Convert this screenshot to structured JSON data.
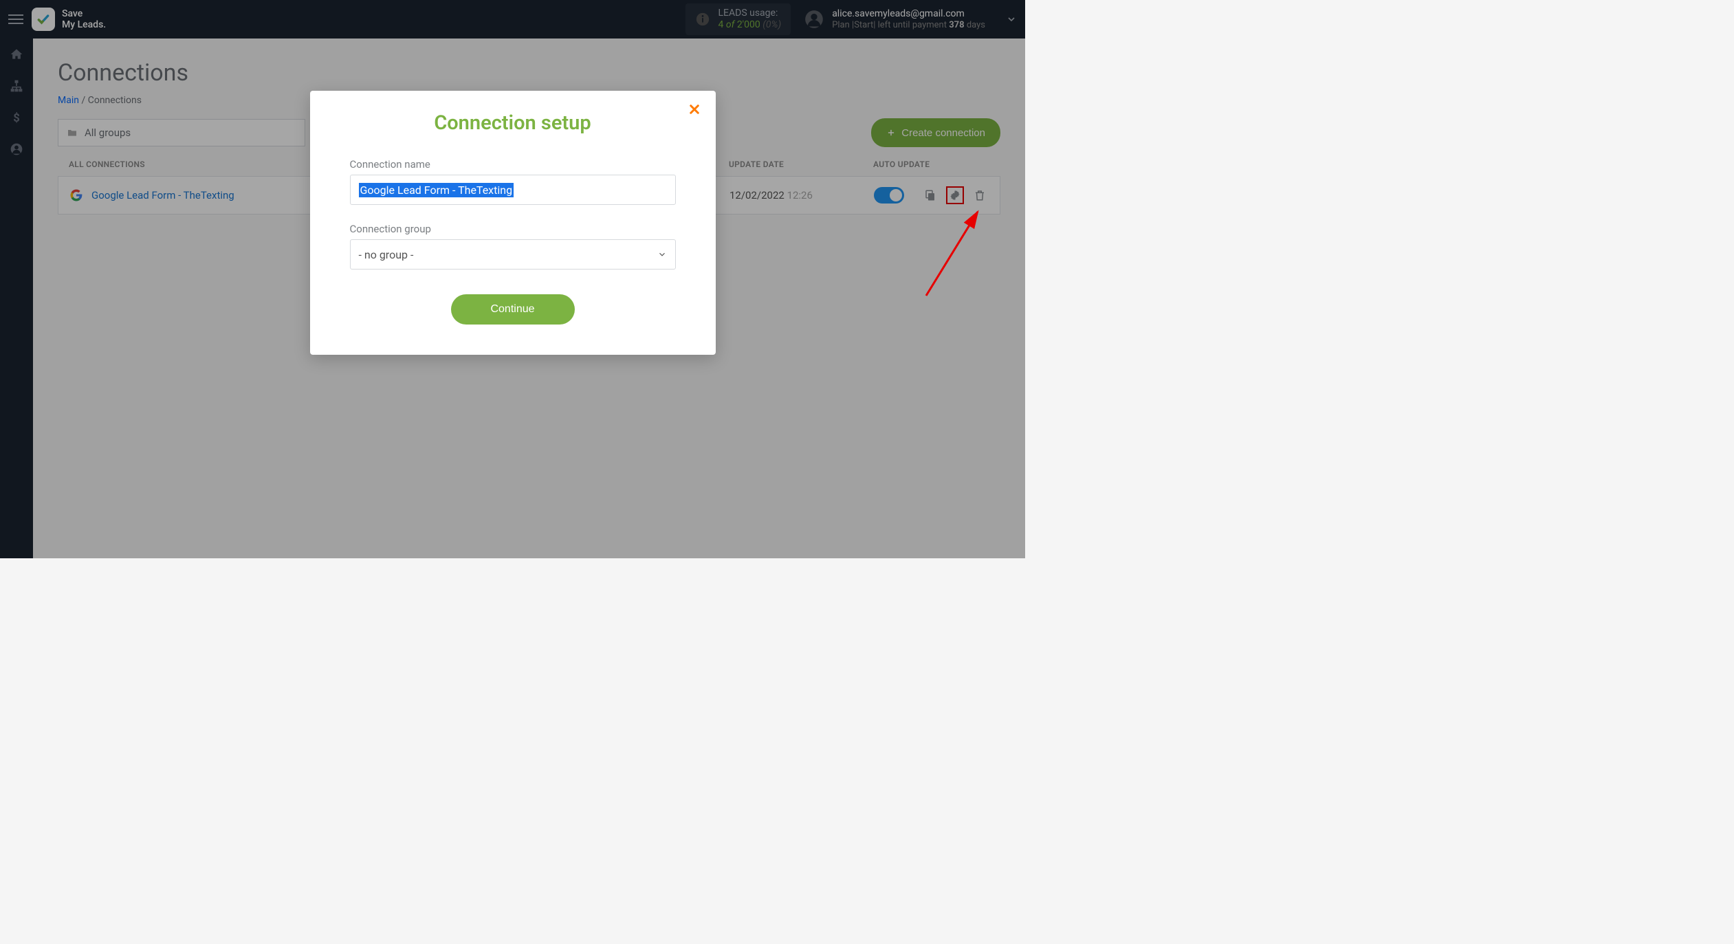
{
  "header": {
    "brand_line1": "Save",
    "brand_line2": "My Leads.",
    "usage_label": "LEADS usage:",
    "usage_value": "4",
    "usage_of": "of",
    "usage_total": "2'000",
    "usage_pct": "(0%)",
    "user_email": "alice.savemyleads@gmail.com",
    "plan_pre": "Plan |Start| left until payment ",
    "plan_days": "378",
    "plan_post": " days"
  },
  "page": {
    "title": "Connections",
    "crumb_main": "Main",
    "crumb_current": "Connections",
    "group_label": "All groups",
    "create_btn": "Create connection"
  },
  "table": {
    "col_name": "ALL CONNECTIONS",
    "col_date": "UPDATE DATE",
    "col_auto": "AUTO UPDATE",
    "row": {
      "name": "Google Lead Form - TheTexting",
      "date": "12/02/2022",
      "time": "12:26"
    }
  },
  "modal": {
    "title": "Connection setup",
    "label_name": "Connection name",
    "input_name": "Google Lead Form - TheTexting",
    "label_group": "Connection group",
    "select_value": "- no group -",
    "continue": "Continue"
  }
}
